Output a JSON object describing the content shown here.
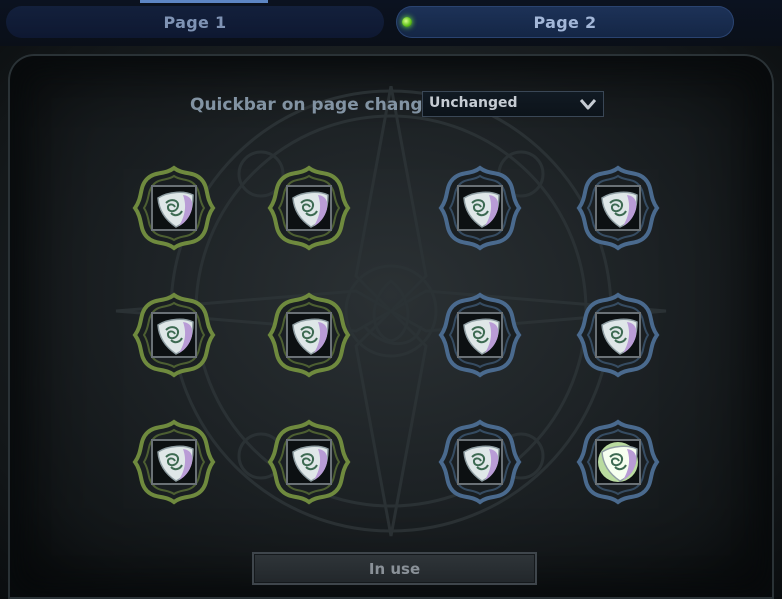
{
  "tabs": [
    {
      "label": "Page 1",
      "active": false
    },
    {
      "label": "Page 2",
      "active": true
    }
  ],
  "quickbar": {
    "label": "Quickbar on page change",
    "selected": "Unchanged"
  },
  "rune_slots": [
    {
      "row": 1,
      "col": 1,
      "frame": "green"
    },
    {
      "row": 1,
      "col": 2,
      "frame": "green"
    },
    {
      "row": 1,
      "col": 3,
      "frame": "blue"
    },
    {
      "row": 1,
      "col": 4,
      "frame": "blue"
    },
    {
      "row": 2,
      "col": 1,
      "frame": "green"
    },
    {
      "row": 2,
      "col": 2,
      "frame": "green"
    },
    {
      "row": 2,
      "col": 3,
      "frame": "blue"
    },
    {
      "row": 2,
      "col": 4,
      "frame": "blue"
    },
    {
      "row": 3,
      "col": 1,
      "frame": "green"
    },
    {
      "row": 3,
      "col": 2,
      "frame": "green"
    },
    {
      "row": 3,
      "col": 3,
      "frame": "blue"
    },
    {
      "row": 3,
      "col": 4,
      "frame": "blue",
      "highlighted": true
    }
  ],
  "in_use_button": {
    "label": "In use"
  },
  "colors": {
    "green_frame": "#6f8a3e",
    "blue_frame": "#4a6a8e",
    "rune_stone": "#dfe7e8",
    "rune_accent": "#b99cd6",
    "active_indicator": "#62c31d"
  }
}
